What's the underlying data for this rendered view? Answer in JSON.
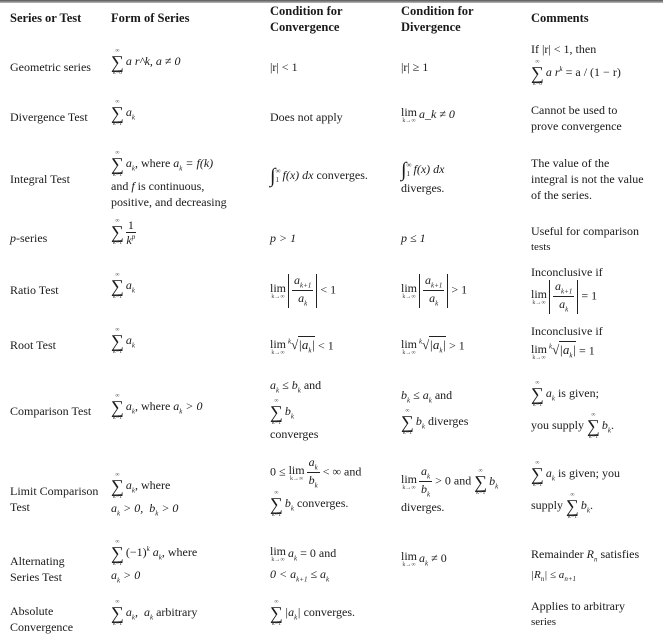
{
  "headers": {
    "series_or_test": "Series or Test",
    "form_of_series": "Form of Series",
    "cond_convergence_1": "Condition for",
    "cond_convergence_2": "Convergence",
    "cond_divergence_1": "Condition for",
    "cond_divergence_2": "Divergence",
    "comments": "Comments"
  },
  "rows": {
    "geometric": {
      "name": "Geometric series",
      "form": "a r^k, a ≠ 0",
      "convergence": "|r| < 1",
      "divergence": "|r| ≥ 1",
      "comment_line1": "If |r| < 1, then",
      "comment_formula": "= a / (1 − r)"
    },
    "divergence": {
      "name": "Divergence Test",
      "form": "a_k",
      "convergence": "Does not apply",
      "divergence": "a_k ≠ 0",
      "comment_line1": "Cannot be used to",
      "comment_line2": "prove convergence"
    },
    "integral": {
      "name": "Integral Test",
      "form_line1": ", where",
      "form_line2": "and",
      "form_line2b": "is continuous,",
      "form_line3": "positive, and decreasing",
      "convergence": "converges.",
      "divergence": "diverges.",
      "comment_line1": "The value of the",
      "comment_line2": "integral is not the value",
      "comment_line3": "of the series."
    },
    "pseries": {
      "name_italic": "p",
      "name_rest": "-series",
      "convergence": "p > 1",
      "divergence": "p ≤ 1",
      "comment_line1": "Useful for comparison",
      "comment_line2": "tests"
    },
    "ratio": {
      "name": "Ratio Test",
      "convergence": "< 1",
      "divergence": "> 1",
      "comment_line1": "Inconclusive if",
      "comment_rel": "= 1"
    },
    "root": {
      "name": "Root Test",
      "convergence": "< 1",
      "divergence": "> 1",
      "comment_line1": "Inconclusive if",
      "comment_rel": "= 1"
    },
    "comparison": {
      "name": "Comparison Test",
      "form": ", where",
      "conv_line1": "and",
      "conv_line3": "converges",
      "div_line1": "and",
      "div_line2": "diverges",
      "comment_line1": "is given;",
      "comment_line2": "you supply"
    },
    "limit_comparison": {
      "name_line1": "Limit Comparison",
      "name_line2": "Test",
      "form_line1": ", where",
      "conv_line1": "< ∞ and",
      "conv_line2": "converges.",
      "div_line1": "> 0 and",
      "div_line2": "diverges.",
      "comment_line1": "is given; you",
      "comment_line2": "supply"
    },
    "alternating": {
      "name_line1": "Alternating",
      "name_line2": "Series Test",
      "form_line1": ", where",
      "conv_line1": "= 0 and",
      "divergence": "≠ 0",
      "comment_line1": "Remainder",
      "comment_line1b": "satisfies"
    },
    "absolute": {
      "name_line1": "Absolute",
      "name_line2": "Convergence",
      "form": "arbitrary",
      "convergence": "converges.",
      "comment_line1": "Applies to arbitrary",
      "comment_line2": "series"
    }
  },
  "symbols": {
    "sum": "∑",
    "infinity": "∞",
    "integral": "∫",
    "lim": "lim",
    "k_to_inf": "k→∞",
    "k0": "k=0",
    "k1": "k=1"
  }
}
